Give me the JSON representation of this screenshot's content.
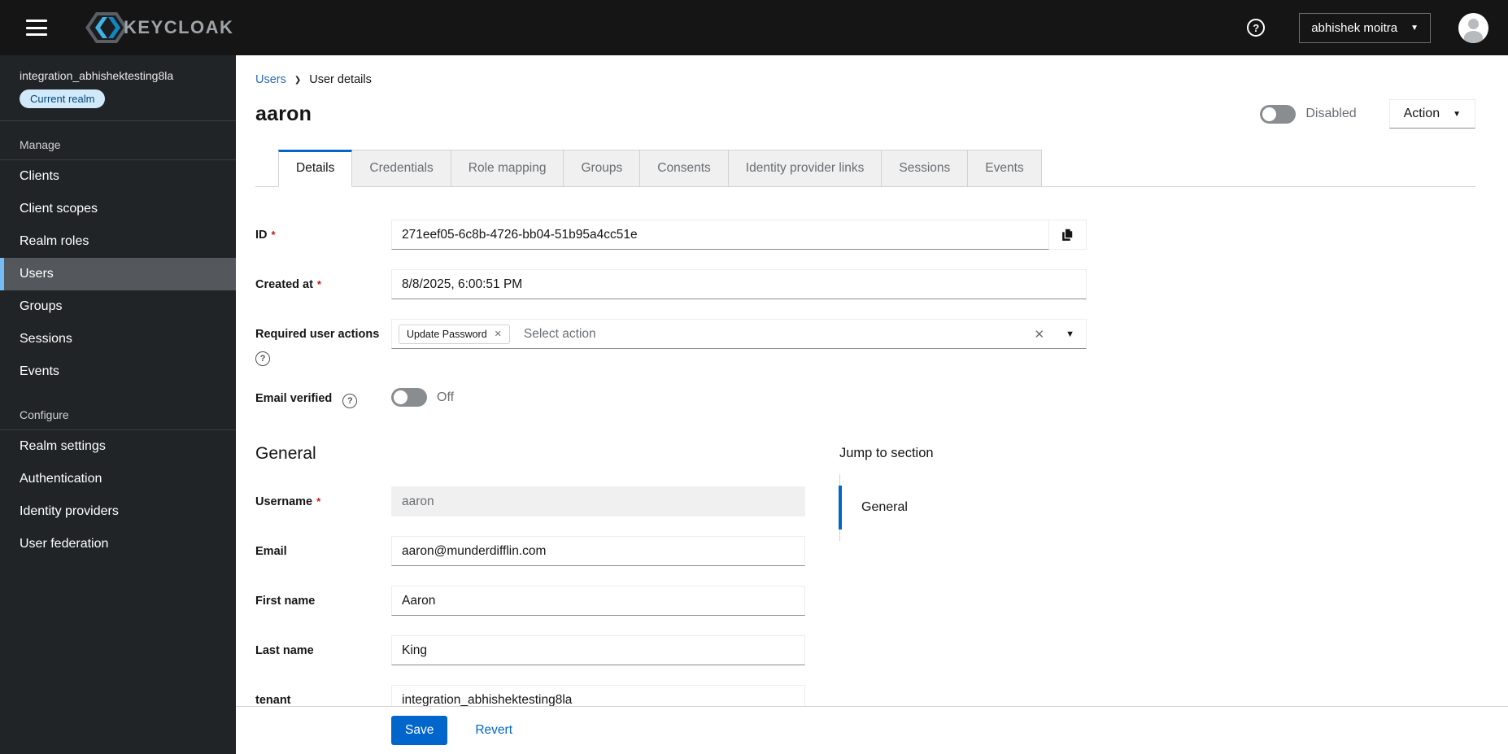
{
  "masthead": {
    "brand": "KEYCLOAK",
    "user_menu": "abhishek moitra"
  },
  "sidebar": {
    "realm": "integration_abhishektesting8la",
    "realm_badge": "Current realm",
    "groups": [
      {
        "title": "Manage",
        "active": "Users",
        "items": [
          "Clients",
          "Client scopes",
          "Realm roles",
          "Users",
          "Groups",
          "Sessions",
          "Events"
        ]
      },
      {
        "title": "Configure",
        "active": "",
        "items": [
          "Realm settings",
          "Authentication",
          "Identity providers",
          "User federation"
        ]
      }
    ]
  },
  "breadcrumb": {
    "parent": "Users",
    "current": "User details"
  },
  "header": {
    "title": "aaron",
    "status_toggle_label": "Disabled",
    "action_button": "Action"
  },
  "tabs": {
    "active": "Details",
    "items": [
      "Details",
      "Credentials",
      "Role mapping",
      "Groups",
      "Consents",
      "Identity provider links",
      "Sessions",
      "Events"
    ]
  },
  "form": {
    "required_marker": "*",
    "id": {
      "label": "ID",
      "value": "271eef05-6c8b-4726-bb04-51b95a4cc51e"
    },
    "created_at": {
      "label": "Created at",
      "value": "8/8/2025, 6:00:51 PM"
    },
    "required_user_actions": {
      "label": "Required user actions",
      "chips": [
        "Update Password"
      ],
      "placeholder": "Select action"
    },
    "email_verified": {
      "label": "Email verified",
      "state": "Off"
    },
    "general_heading": "General",
    "username": {
      "label": "Username",
      "value": "aaron"
    },
    "email": {
      "label": "Email",
      "value": "aaron@munderdifflin.com"
    },
    "first_name": {
      "label": "First name",
      "value": "Aaron"
    },
    "last_name": {
      "label": "Last name",
      "value": "King"
    },
    "tenant": {
      "label": "tenant",
      "value": "integration_abhishektesting8la"
    }
  },
  "jump_nav": {
    "title": "Jump to section",
    "items": [
      "General"
    ]
  },
  "footer": {
    "save": "Save",
    "revert": "Revert"
  },
  "colors": {
    "accent": "#0066cc",
    "masthead_bg": "#151515",
    "sidebar_bg": "#212427",
    "nav_active_bg": "#54585c",
    "nav_active_bar": "#73bcf7",
    "badge_bg": "#d2e9fa",
    "badge_text": "#004678",
    "required_red": "#c9190b"
  }
}
